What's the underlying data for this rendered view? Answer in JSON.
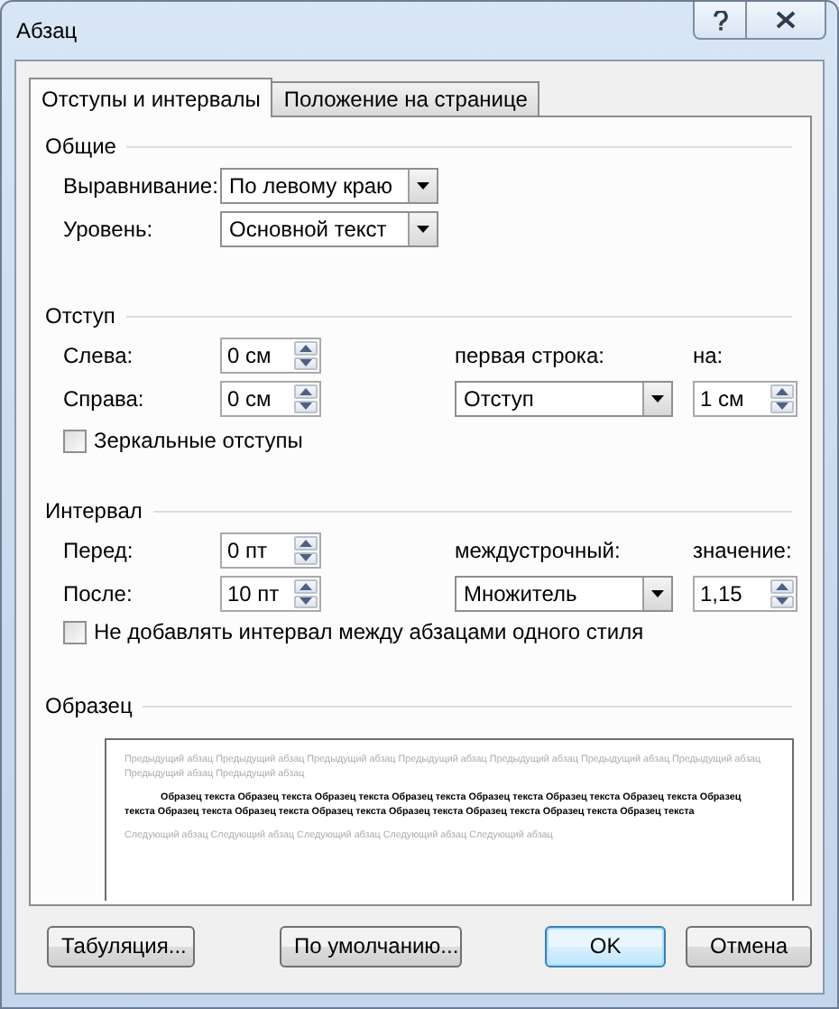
{
  "window": {
    "title": "Абзац"
  },
  "tabs": [
    {
      "label": "Отступы и интервалы",
      "selected": true
    },
    {
      "label": "Положение на странице",
      "selected": false
    }
  ],
  "general": {
    "title": "Общие",
    "alignment": {
      "label": "Выравнивание:",
      "value": "По левому краю"
    },
    "level": {
      "label": "Уровень:",
      "value": "Основной текст"
    }
  },
  "indent": {
    "title": "Отступ",
    "left": {
      "label": "Слева:",
      "value": "0 см"
    },
    "right": {
      "label": "Справа:",
      "value": "0 см"
    },
    "first_line": {
      "label": "первая строка:",
      "value": "Отступ"
    },
    "by": {
      "label": "на:",
      "value": "1 см"
    },
    "mirror": {
      "label": "Зеркальные отступы",
      "checked": false
    }
  },
  "spacing": {
    "title": "Интервал",
    "before": {
      "label": "Перед:",
      "value": "0 пт"
    },
    "after": {
      "label": "После:",
      "value": "10 пт"
    },
    "line_spacing": {
      "label": "междустрочный:",
      "value": "Множитель"
    },
    "at": {
      "label": "значение:",
      "value": "1,15"
    },
    "dont_add": {
      "label": "Не добавлять интервал между абзацами одного стиля",
      "checked": false
    }
  },
  "preview": {
    "title": "Образец",
    "previous": "Предыдущий абзац Предыдущий абзац Предыдущий абзац Предыдущий абзац Предыдущий абзац Предыдущий абзац Предыдущий абзац Предыдущий абзац Предыдущий абзац",
    "sample": "Образец текста Образец текста Образец текста Образец текста Образец текста Образец текста Образец текста Образец текста Образец текста Образец текста Образец текста Образец текста Образец текста Образец текста Образец текста",
    "next": "Следующий абзац Следующий абзац Следующий абзац Следующий абзац Следующий абзац"
  },
  "buttons": [
    {
      "label": "Табуляция...",
      "default": false
    },
    {
      "label": "По умолчанию...",
      "default": false
    },
    {
      "label": "OK",
      "default": true
    },
    {
      "label": "Отмена",
      "default": false
    }
  ]
}
